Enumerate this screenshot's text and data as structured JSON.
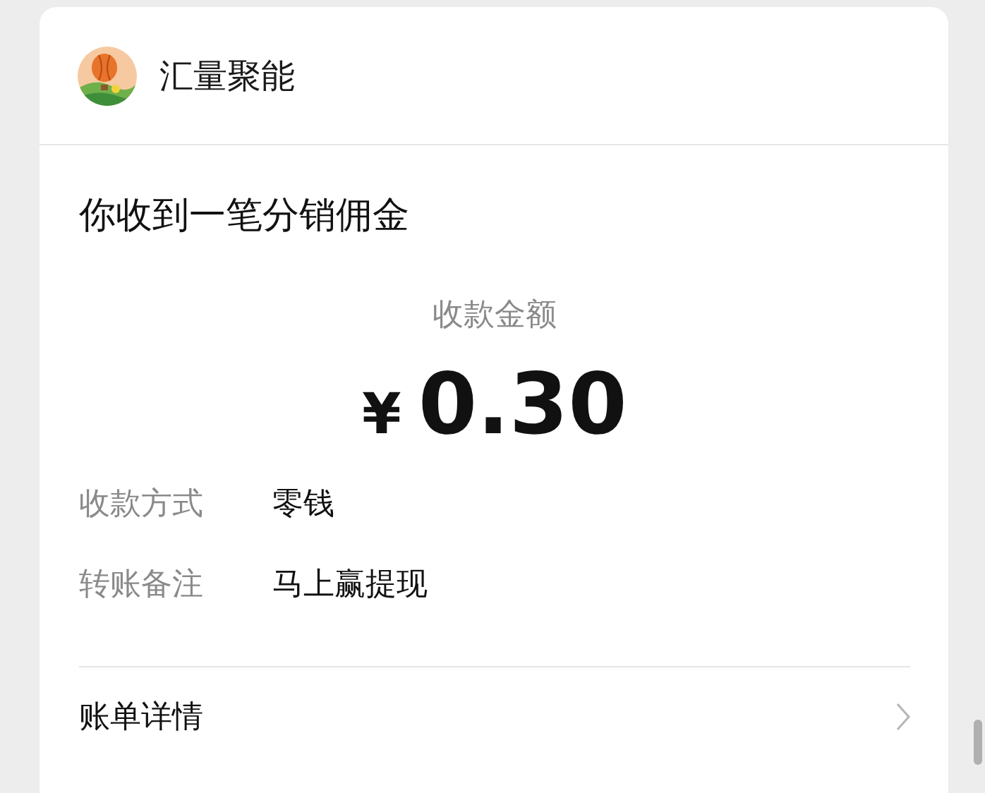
{
  "app": {
    "name": "汇量聚能"
  },
  "message": {
    "title": "你收到一笔分销佣金",
    "amount_label": "收款金额",
    "currency": "¥",
    "amount": "0.30",
    "fields": [
      {
        "label": "收款方式",
        "value": "零钱"
      },
      {
        "label": "转账备注",
        "value": "马上赢提现"
      }
    ]
  },
  "footer": {
    "label": "账单详情"
  }
}
